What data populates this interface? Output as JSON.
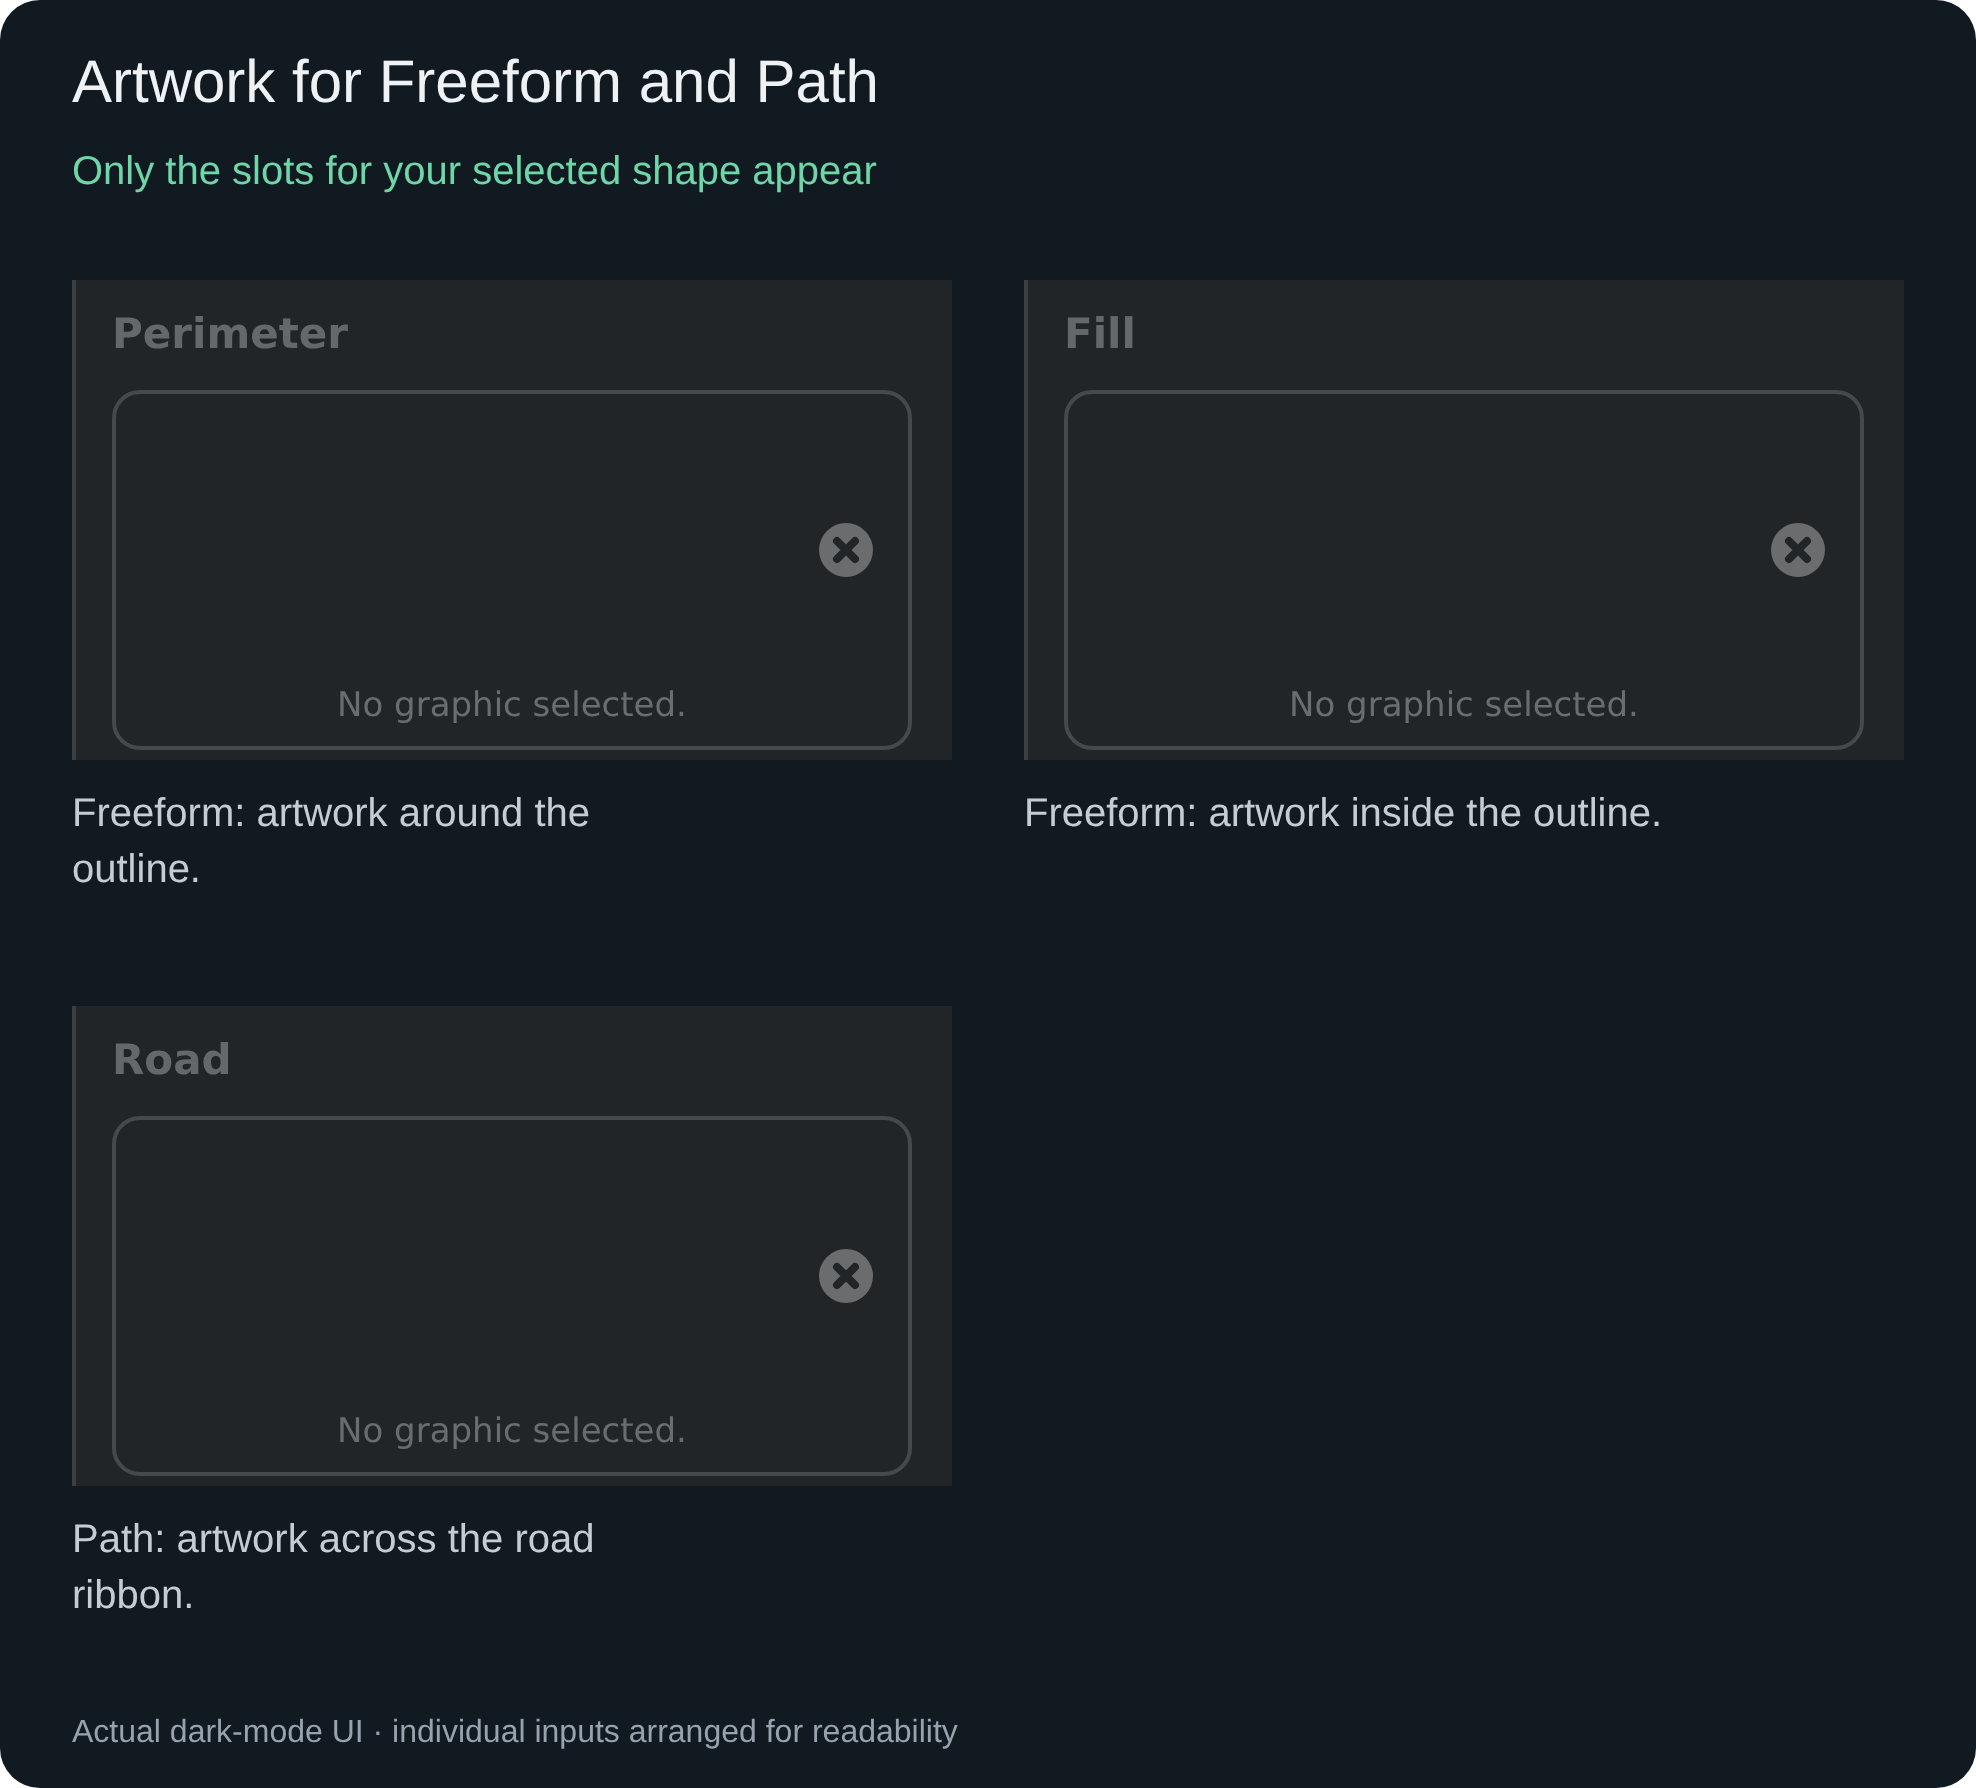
{
  "title": "Artwork for Freeform and Path",
  "subtitle": "Only the slots for your selected shape appear",
  "slots": [
    {
      "label": "Perimeter",
      "empty_text": "No graphic selected.",
      "caption": "Freeform: artwork around the outline."
    },
    {
      "label": "Fill",
      "empty_text": "No graphic selected.",
      "caption": "Freeform: artwork inside the outline."
    },
    {
      "label": "Road",
      "empty_text": "No graphic selected.",
      "caption": "Path: artwork across the road ribbon."
    }
  ],
  "footer": "Actual dark-mode UI · individual inputs arranged for readability"
}
